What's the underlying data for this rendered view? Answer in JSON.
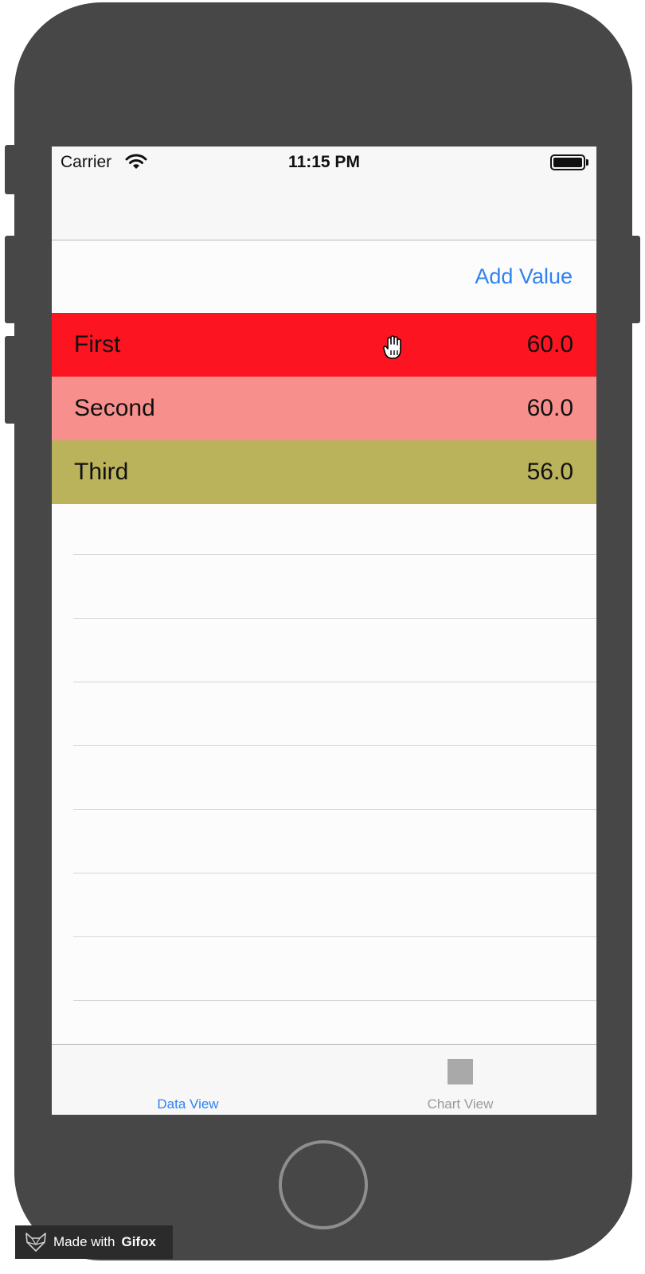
{
  "status_bar": {
    "carrier": "Carrier",
    "time": "11:15 PM"
  },
  "header": {
    "add_value_label": "Add Value"
  },
  "rows": [
    {
      "name": "First",
      "value": "60.0",
      "color": "#fc1421"
    },
    {
      "name": "Second",
      "value": "60.0",
      "color": "#f7908d"
    },
    {
      "name": "Third",
      "value": "56.0",
      "color": "#bbb35b"
    }
  ],
  "tab_bar": {
    "tabs": [
      {
        "label": "Data View",
        "selected": true,
        "color": "#2f83f0"
      },
      {
        "label": "Chart View",
        "selected": false,
        "color": "#9a9a9a"
      }
    ]
  },
  "watermark": {
    "prefix": "Made with",
    "brand": "Gifox"
  },
  "icons": [
    "wifi-icon",
    "battery-icon",
    "hand-cursor-icon",
    "chart-view-icon",
    "gifox-logo-icon"
  ]
}
